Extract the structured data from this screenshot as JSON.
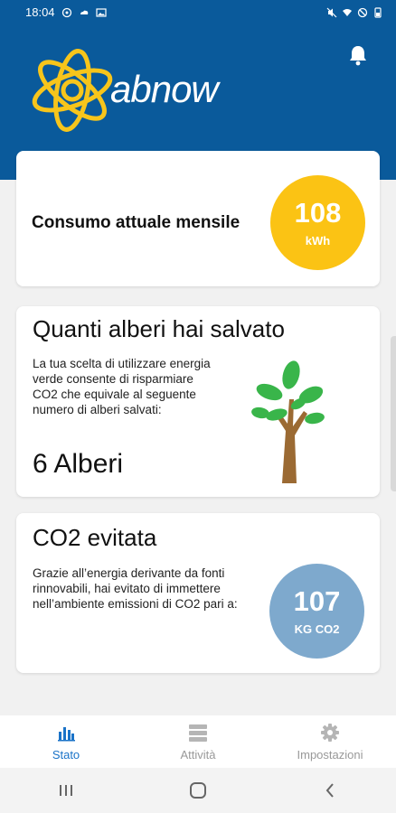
{
  "status_bar": {
    "time": "18:04"
  },
  "header": {
    "logo_text": "abnow",
    "brand_color": "#0a5a9b",
    "logo_color": "#f7c51b"
  },
  "consumo": {
    "label": "Consumo attuale mensile",
    "value": "108",
    "unit": "kWh",
    "color": "#fbc314"
  },
  "alberi": {
    "title": "Quanti alberi hai salvato",
    "description": "La tua scelta di utilizzare energia verde consente di risparmiare CO2 che equivale al seguente numero di alberi salvati:",
    "count": "6 Alberi",
    "icon": "tree-icon"
  },
  "co2": {
    "title": "CO2 evitata",
    "description": "Grazie all’energia derivante da fonti rinnovabili, hai evitato di immettere nell’ambiente emissioni di CO2 pari  a:",
    "value": "107",
    "unit": "KG CO2",
    "color": "#7ea9cd"
  },
  "bottom_nav": {
    "items": [
      {
        "label": "Stato",
        "icon": "bar-chart-icon",
        "active": true
      },
      {
        "label": "Attività",
        "icon": "server-icon",
        "active": false
      },
      {
        "label": "Impostazioni",
        "icon": "gear-icon",
        "active": false
      }
    ],
    "active_color": "#1a73c8"
  }
}
